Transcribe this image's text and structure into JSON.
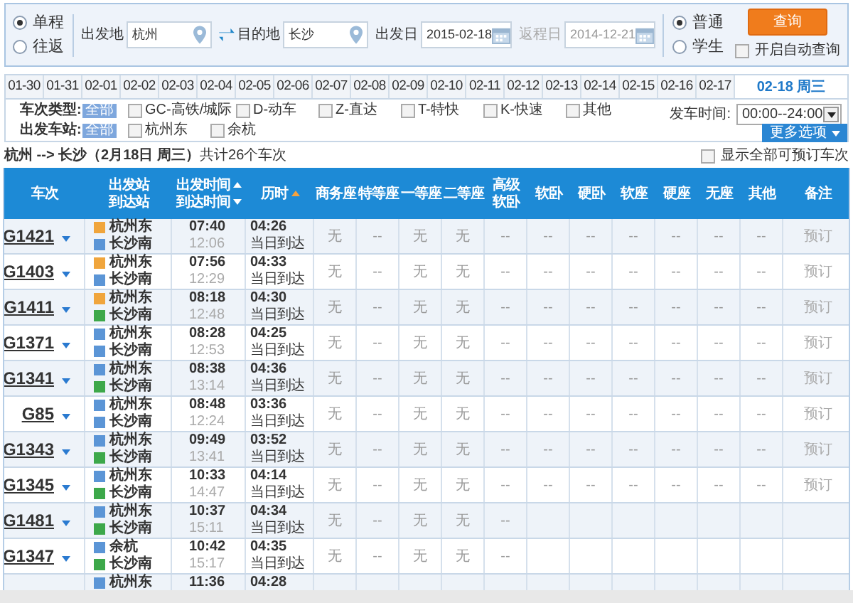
{
  "trip_type": [
    {
      "label": "单程",
      "selected": true
    },
    {
      "label": "往返",
      "selected": false
    }
  ],
  "from": {
    "label": "出发地",
    "value": "杭州"
  },
  "to": {
    "label": "目的地",
    "value": "长沙"
  },
  "depart_date": {
    "label": "出发日",
    "value": "2015-02-18"
  },
  "return_date": {
    "label": "返程日",
    "value": "2014-12-21",
    "disabled": true
  },
  "passenger_type": [
    {
      "label": "普通",
      "selected": true
    },
    {
      "label": "学生",
      "selected": false
    }
  ],
  "query_button": "查询",
  "auto_query": {
    "label": "开启自动查询",
    "checked": false
  },
  "date_tabs": [
    {
      "label": "01-30",
      "selected": false
    },
    {
      "label": "01-31",
      "selected": false
    },
    {
      "label": "02-01",
      "selected": false
    },
    {
      "label": "02-02",
      "selected": false
    },
    {
      "label": "02-03",
      "selected": false
    },
    {
      "label": "02-04",
      "selected": false
    },
    {
      "label": "02-05",
      "selected": false
    },
    {
      "label": "02-06",
      "selected": false
    },
    {
      "label": "02-07",
      "selected": false
    },
    {
      "label": "02-08",
      "selected": false
    },
    {
      "label": "02-09",
      "selected": false
    },
    {
      "label": "02-10",
      "selected": false
    },
    {
      "label": "02-11",
      "selected": false
    },
    {
      "label": "02-12",
      "selected": false
    },
    {
      "label": "02-13",
      "selected": false
    },
    {
      "label": "02-14",
      "selected": false
    },
    {
      "label": "02-15",
      "selected": false
    },
    {
      "label": "02-16",
      "selected": false
    },
    {
      "label": "02-17",
      "selected": false
    },
    {
      "label": "02-18 周三",
      "selected": true
    }
  ],
  "filters": {
    "train_type": {
      "label": "车次类型:",
      "all": {
        "label": "全部",
        "selected": true
      },
      "options": [
        {
          "label": "GC-高铁/城际",
          "checked": false
        },
        {
          "label": "D-动车",
          "checked": false
        },
        {
          "label": "Z-直达",
          "checked": false
        },
        {
          "label": "T-特快",
          "checked": false
        },
        {
          "label": "K-快速",
          "checked": false
        },
        {
          "label": "其他",
          "checked": false
        }
      ]
    },
    "station": {
      "label": "出发车站:",
      "all": {
        "label": "全部",
        "selected": true
      },
      "options": [
        {
          "label": "杭州东",
          "checked": false
        },
        {
          "label": "余杭",
          "checked": false
        }
      ]
    },
    "departure_time": {
      "label": "发车时间:",
      "value": "00:00--24:00"
    }
  },
  "more_options": "更多选项",
  "summary": "**杭州 --> 长沙（2月18日 周三）**共计26个车次",
  "show_all": {
    "label": "显示全部可预订车次",
    "checked": false
  },
  "table": {
    "columns": [
      {
        "lines": [
          "车次"
        ]
      },
      {
        "lines": [
          "出发站",
          "到达站"
        ]
      },
      {
        "lines": [
          "出发时间",
          "到达时间"
        ],
        "sorts": [
          {
            "kind": "asc",
            "active": false
          },
          {
            "kind": "desc",
            "active": false
          }
        ]
      },
      {
        "lines": [
          "历时"
        ],
        "sorts": [
          {
            "kind": "asc",
            "active": true
          }
        ]
      },
      {
        "lines": [
          "商务座"
        ]
      },
      {
        "lines": [
          "特等座"
        ]
      },
      {
        "lines": [
          "一等座"
        ]
      },
      {
        "lines": [
          "二等座"
        ]
      },
      {
        "lines": [
          "高级",
          "软卧"
        ]
      },
      {
        "lines": [
          "软卧"
        ]
      },
      {
        "lines": [
          "硬卧"
        ]
      },
      {
        "lines": [
          "软座"
        ]
      },
      {
        "lines": [
          "硬座"
        ]
      },
      {
        "lines": [
          "无座"
        ]
      },
      {
        "lines": [
          "其他"
        ]
      },
      {
        "lines": [
          "备注"
        ]
      }
    ],
    "rows": [
      {
        "train": "G1421",
        "from": {
          "name": "杭州东",
          "kind": "start"
        },
        "to": {
          "name": "长沙南",
          "kind": "pass"
        },
        "depart": "07:40",
        "arrive": "12:06",
        "duration": "04:26",
        "arrival_day": "当日到达",
        "seats": [
          "无",
          "--",
          "无",
          "无",
          "--",
          "--",
          "--",
          "--",
          "--",
          "--",
          "--"
        ],
        "note": "预订"
      },
      {
        "train": "G1403",
        "from": {
          "name": "杭州东",
          "kind": "start"
        },
        "to": {
          "name": "长沙南",
          "kind": "pass"
        },
        "depart": "07:56",
        "arrive": "12:29",
        "duration": "04:33",
        "arrival_day": "当日到达",
        "seats": [
          "无",
          "--",
          "无",
          "无",
          "--",
          "--",
          "--",
          "--",
          "--",
          "--",
          "--"
        ],
        "note": "预订"
      },
      {
        "train": "G1411",
        "from": {
          "name": "杭州东",
          "kind": "start"
        },
        "to": {
          "name": "长沙南",
          "kind": "end"
        },
        "depart": "08:18",
        "arrive": "12:48",
        "duration": "04:30",
        "arrival_day": "当日到达",
        "seats": [
          "无",
          "--",
          "无",
          "无",
          "--",
          "--",
          "--",
          "--",
          "--",
          "--",
          "--"
        ],
        "note": "预订"
      },
      {
        "train": "G1371",
        "from": {
          "name": "杭州东",
          "kind": "pass"
        },
        "to": {
          "name": "长沙南",
          "kind": "pass"
        },
        "depart": "08:28",
        "arrive": "12:53",
        "duration": "04:25",
        "arrival_day": "当日到达",
        "seats": [
          "无",
          "--",
          "无",
          "无",
          "--",
          "--",
          "--",
          "--",
          "--",
          "--",
          "--"
        ],
        "note": "预订"
      },
      {
        "train": "G1341",
        "from": {
          "name": "杭州东",
          "kind": "pass"
        },
        "to": {
          "name": "长沙南",
          "kind": "end"
        },
        "depart": "08:38",
        "arrive": "13:14",
        "duration": "04:36",
        "arrival_day": "当日到达",
        "seats": [
          "无",
          "--",
          "无",
          "无",
          "--",
          "--",
          "--",
          "--",
          "--",
          "--",
          "--"
        ],
        "note": "预订"
      },
      {
        "train": "G85",
        "from": {
          "name": "杭州东",
          "kind": "pass"
        },
        "to": {
          "name": "长沙南",
          "kind": "pass"
        },
        "depart": "08:48",
        "arrive": "12:24",
        "duration": "03:36",
        "arrival_day": "当日到达",
        "seats": [
          "无",
          "--",
          "无",
          "无",
          "--",
          "--",
          "--",
          "--",
          "--",
          "--",
          "--"
        ],
        "note": "预订"
      },
      {
        "train": "G1343",
        "from": {
          "name": "杭州东",
          "kind": "pass"
        },
        "to": {
          "name": "长沙南",
          "kind": "end"
        },
        "depart": "09:49",
        "arrive": "13:41",
        "duration": "03:52",
        "arrival_day": "当日到达",
        "seats": [
          "无",
          "--",
          "无",
          "无",
          "--",
          "--",
          "--",
          "--",
          "--",
          "--",
          "--"
        ],
        "note": "预订"
      },
      {
        "train": "G1345",
        "from": {
          "name": "杭州东",
          "kind": "pass"
        },
        "to": {
          "name": "长沙南",
          "kind": "end"
        },
        "depart": "10:33",
        "arrive": "14:47",
        "duration": "04:14",
        "arrival_day": "当日到达",
        "seats": [
          "无",
          "--",
          "无",
          "无",
          "--",
          "--",
          "--",
          "--",
          "--",
          "--",
          "--"
        ],
        "note": "预订"
      },
      {
        "train": "G1481",
        "from": {
          "name": "杭州东",
          "kind": "pass"
        },
        "to": {
          "name": "长沙南",
          "kind": "end"
        },
        "depart": "10:37",
        "arrive": "15:11",
        "duration": "04:34",
        "arrival_day": "当日到达",
        "seats": [
          "无",
          "--",
          "无",
          "无",
          "--"
        ]
      },
      {
        "train": "G1347",
        "from": {
          "name": "余杭",
          "kind": "pass"
        },
        "to": {
          "name": "长沙南",
          "kind": "end"
        },
        "depart": "10:42",
        "arrive": "15:17",
        "duration": "04:35",
        "arrival_day": "当日到达",
        "seats": [
          "无",
          "--",
          "无",
          "无",
          "--"
        ]
      },
      {
        "from": {
          "name": "杭州东",
          "kind": "pass"
        },
        "depart": "11:36",
        "duration": "04:28"
      }
    ]
  }
}
